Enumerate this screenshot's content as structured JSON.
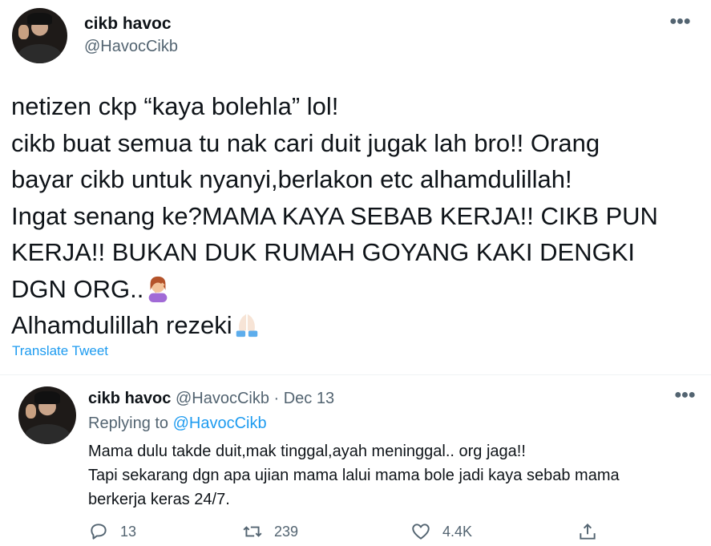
{
  "main_tweet": {
    "name": "cikb havoc",
    "handle": "@HavocCikb",
    "lines": [
      "netizen ckp “kaya bolehla” lol!",
      "cikb buat semua tu nak cari duit jugak lah bro!! Orang",
      "bayar cikb untuk nyanyi,berlakon etc alhamdulillah!",
      "Ingat senang ke?MAMA KAYA SEBAB KERJA!! CIKB PUN",
      "KERJA!! BUKAN DUK RUMAH GOYANG KAKI DENGKI",
      "DGN ORG..",
      "Alhamdulillah rezeki"
    ],
    "translate_label": "Translate Tweet"
  },
  "reply_tweet": {
    "name": "cikb havoc",
    "handle_date": "@HavocCikb · Dec 13",
    "replying_prefix": "Replying to",
    "replying_to": "@HavocCikb",
    "lines": [
      "Mama dulu takde duit,mak tinggal,ayah meninggal.. org jaga!!",
      "Tapi sekarang dgn apa ujian mama lalui mama bole jadi kaya sebab mama",
      "berkerja keras 24/7."
    ],
    "actions": {
      "replies": "13",
      "retweets": "239",
      "likes": "4.4K"
    }
  },
  "colors": {
    "accent": "#1d9bf0",
    "secondary_text": "#536471",
    "divider": "#eff3f4"
  },
  "icons": [
    "more-icon",
    "reply-icon",
    "retweet-icon",
    "like-icon",
    "share-icon",
    "facepalm-emoji",
    "folded-hands-emoji"
  ]
}
